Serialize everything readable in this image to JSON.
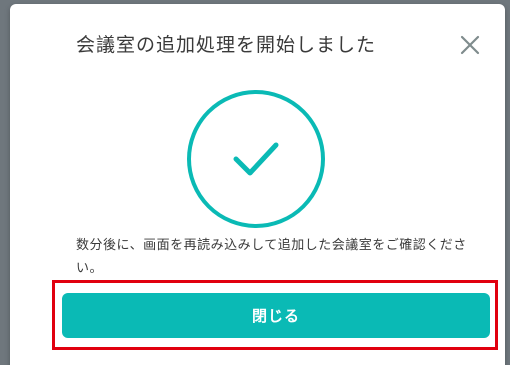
{
  "dialog": {
    "title": "会議室の追加処理を開始しました",
    "message_line1": "数分後に、画面を再読み込みして追加した会議室をご確認くださ",
    "message_line2": "い。",
    "close_button_label": "閉じる",
    "close_icon": "close-icon",
    "status_icon": "checkmark-circle-icon"
  },
  "colors": {
    "accent": "#0abab5",
    "highlight_border": "#e1000f",
    "text": "#3a3a3a",
    "close_icon": "#7f8c8d"
  }
}
